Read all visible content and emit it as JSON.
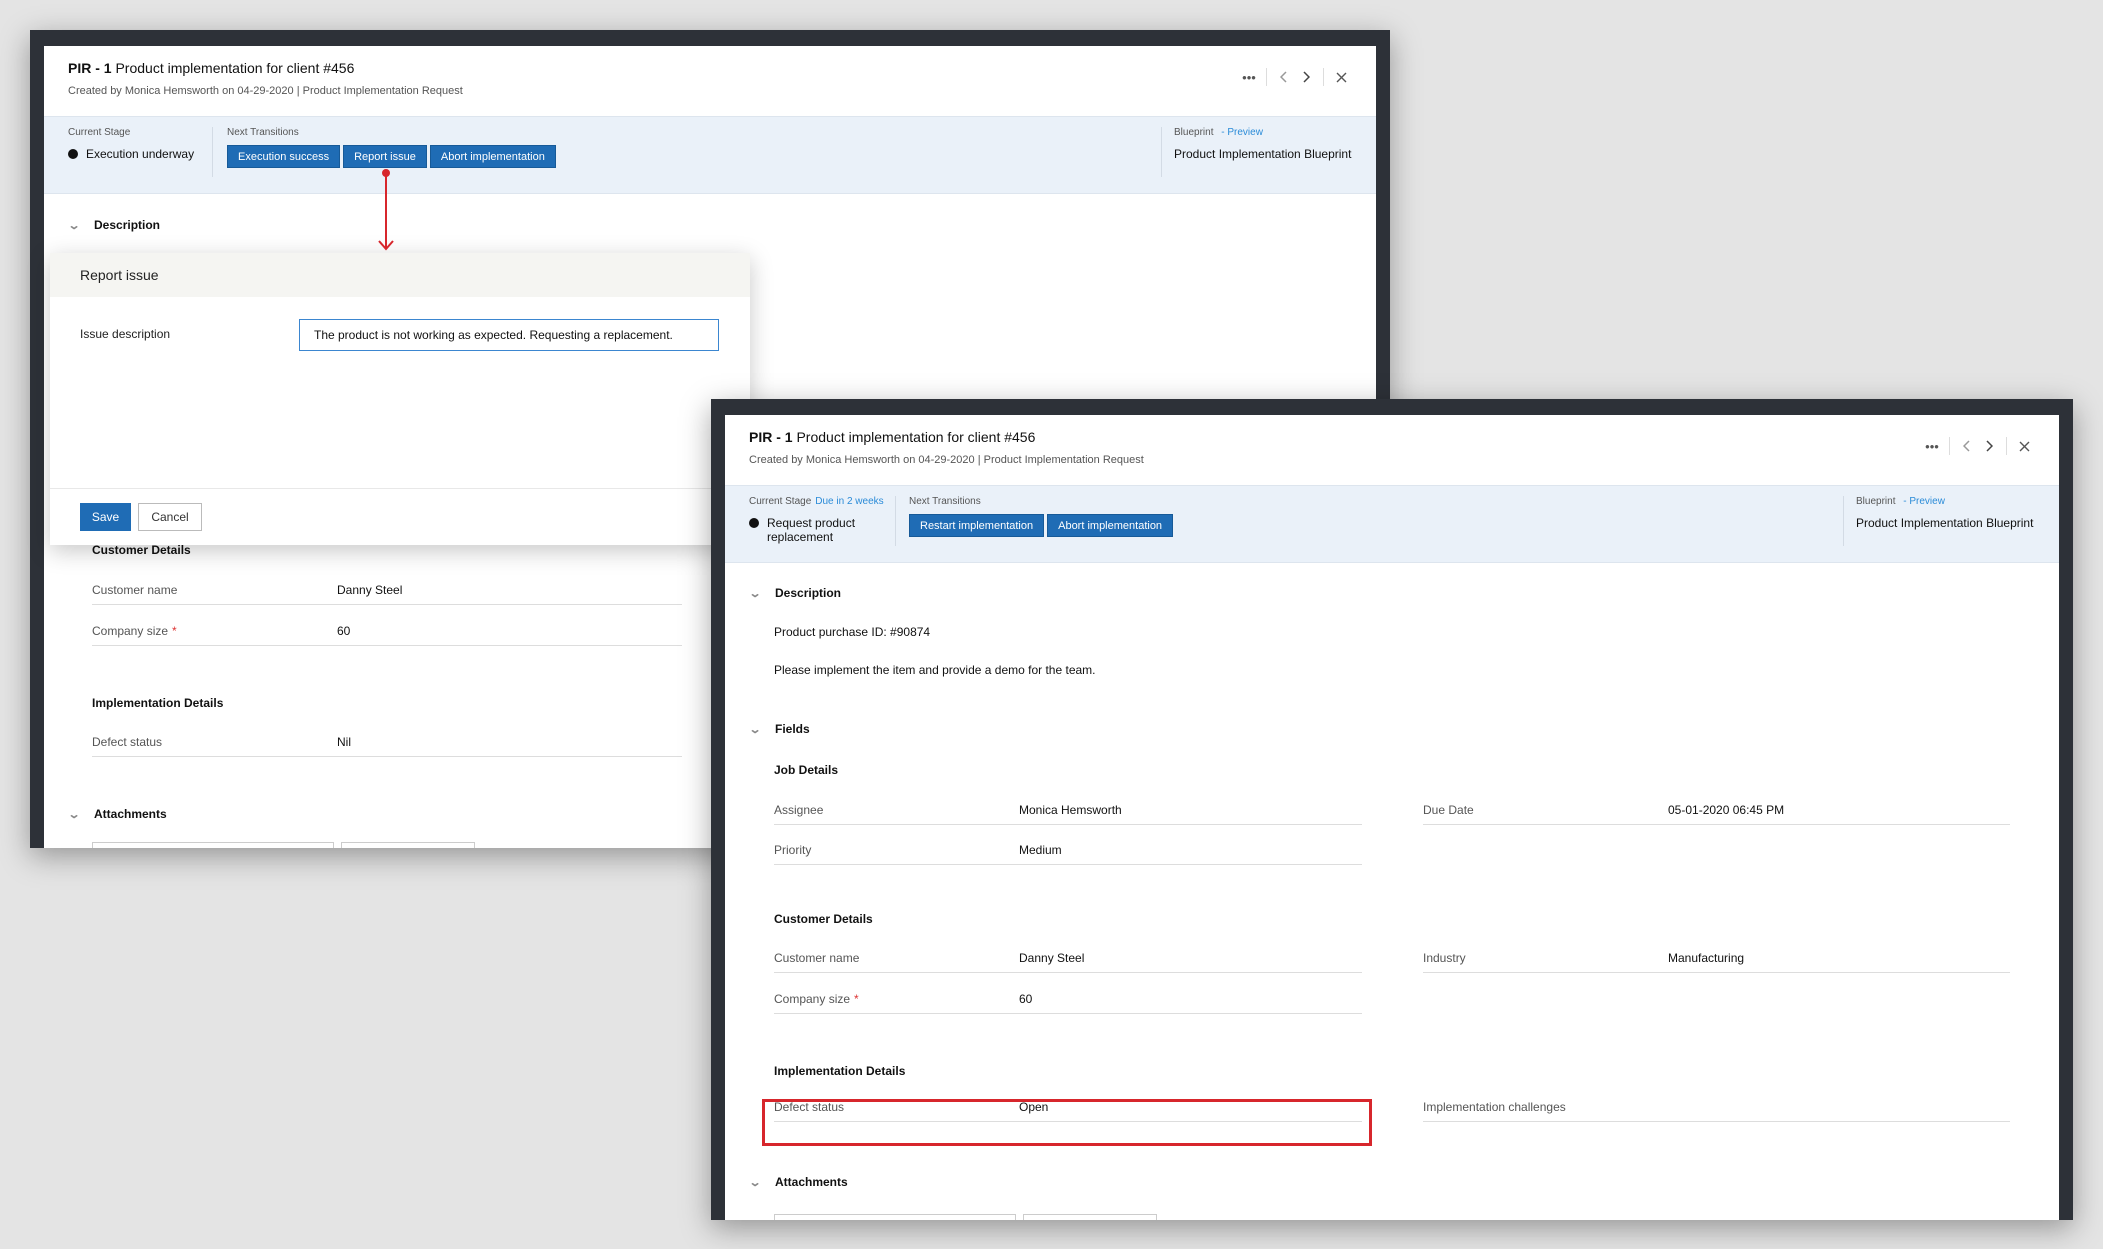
{
  "window_a": {
    "pir": "PIR - 1",
    "title": "Product implementation for client #456",
    "created_by_label": "Created by",
    "author": "Monica Hemsworth",
    "on": "on 04-29-2020",
    "module": "| Product Implementation Request",
    "stage_label": "Current Stage",
    "stage_value": "Execution underway",
    "next_label": "Next Transitions",
    "transitions": [
      "Execution success",
      "Report issue",
      "Abort implementation"
    ],
    "blueprint_label": "Blueprint",
    "blueprint_preview": "- Preview",
    "blueprint_value": "Product Implementation Blueprint",
    "description_section": "Description",
    "customer_details": "Customer Details",
    "customer_name_label": "Customer name",
    "customer_name_value": "Danny Steel",
    "company_size_label": "Company size",
    "company_size_value": "60",
    "required_mark": "*",
    "implementation_details": "Implementation Details",
    "defect_status_label": "Defect status",
    "defect_status_value": "Nil",
    "attachments_section": "Attachments"
  },
  "dialog": {
    "title": "Report issue",
    "field_label": "Issue description",
    "field_value": "The product is not working as expected. Requesting a replacement.",
    "save": "Save",
    "cancel": "Cancel"
  },
  "window_b": {
    "pir": "PIR - 1",
    "title": "Product implementation for client #456",
    "created_by_label": "Created by",
    "author": "Monica Hemsworth",
    "on": "on 04-29-2020",
    "module": "| Product Implementation Request",
    "stage_label": "Current Stage",
    "due": "Due in 2 weeks",
    "stage_value": "Request product replacement",
    "next_label": "Next Transitions",
    "transitions": [
      "Restart implementation",
      "Abort implementation"
    ],
    "blueprint_label": "Blueprint",
    "blueprint_preview": "- Preview",
    "blueprint_value": "Product Implementation Blueprint",
    "description_section": "Description",
    "desc_line1": "Product purchase ID: #90874",
    "desc_line2": "Please implement the item and provide a demo for the team.",
    "fields_section": "Fields",
    "job_details": "Job Details",
    "assignee_label": "Assignee",
    "assignee_value": "Monica Hemsworth",
    "due_date_label": "Due Date",
    "due_date_value": "05-01-2020 06:45 PM",
    "priority_label": "Priority",
    "priority_value": "Medium",
    "customer_details": "Customer Details",
    "customer_name_label": "Customer name",
    "customer_name_value": "Danny Steel",
    "industry_label": "Industry",
    "industry_value": "Manufacturing",
    "company_size_label": "Company size",
    "company_size_value": "60",
    "required_mark": "*",
    "implementation_details": "Implementation Details",
    "defect_status_label": "Defect status",
    "defect_status_value": "Open",
    "implementation_challenges_label": "Implementation challenges",
    "attachments_section": "Attachments"
  },
  "icons": {
    "more": "more-icon",
    "prev": "chevron-left-icon",
    "next": "chevron-right-icon",
    "close": "close-icon",
    "collapse": "chevron-down-icon"
  },
  "colors": {
    "accent": "#1f6cb5",
    "stage_bar": "#eaf1f9",
    "highlight": "#d7262c",
    "frame": "#2d3138"
  }
}
